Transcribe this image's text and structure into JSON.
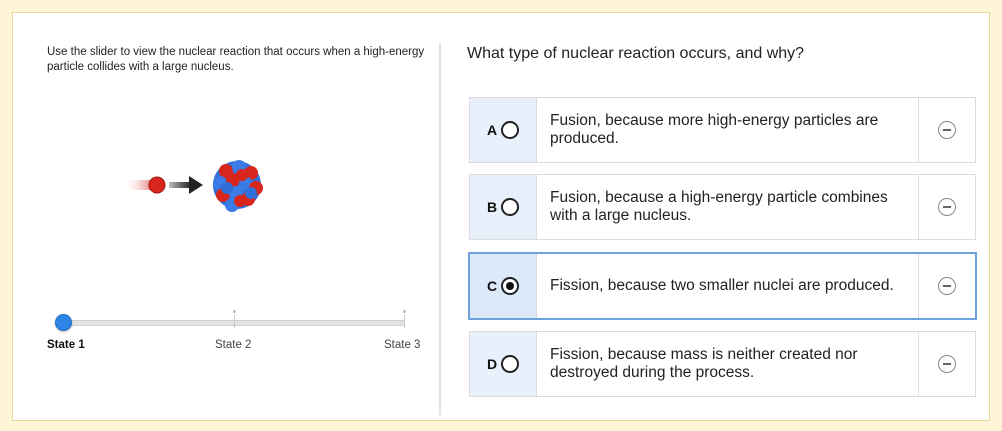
{
  "instruction": "Use the slider to view the nuclear reaction that occurs when a high-energy particle collides with a large nucleus.",
  "slider": {
    "states": [
      "State 1",
      "State 2",
      "State 3"
    ],
    "current_state": "State 1",
    "value_fraction": 0
  },
  "illustration": {
    "particle_color": "#d9261c",
    "nucleus_colors": [
      "#d9261c",
      "#2e6fd9"
    ]
  },
  "question": "What type of nuclear reaction occurs, and why?",
  "choices": [
    {
      "letter": "A",
      "text": "Fusion, because more high-energy particles are produced.",
      "selected": false
    },
    {
      "letter": "B",
      "text": "Fusion, because a high-energy particle combines with a large nucleus.",
      "selected": false
    },
    {
      "letter": "C",
      "text": "Fission, because two smaller nuclei are produced.",
      "selected": true
    },
    {
      "letter": "D",
      "text": "Fission, because mass is neither created nor destroyed during the process.",
      "selected": false
    }
  ],
  "colors": {
    "page_background": "#fdf5d6",
    "accent": "#2d86e8",
    "selected_border": "#6da3dc",
    "letter_cell": "#e8f1fb"
  }
}
